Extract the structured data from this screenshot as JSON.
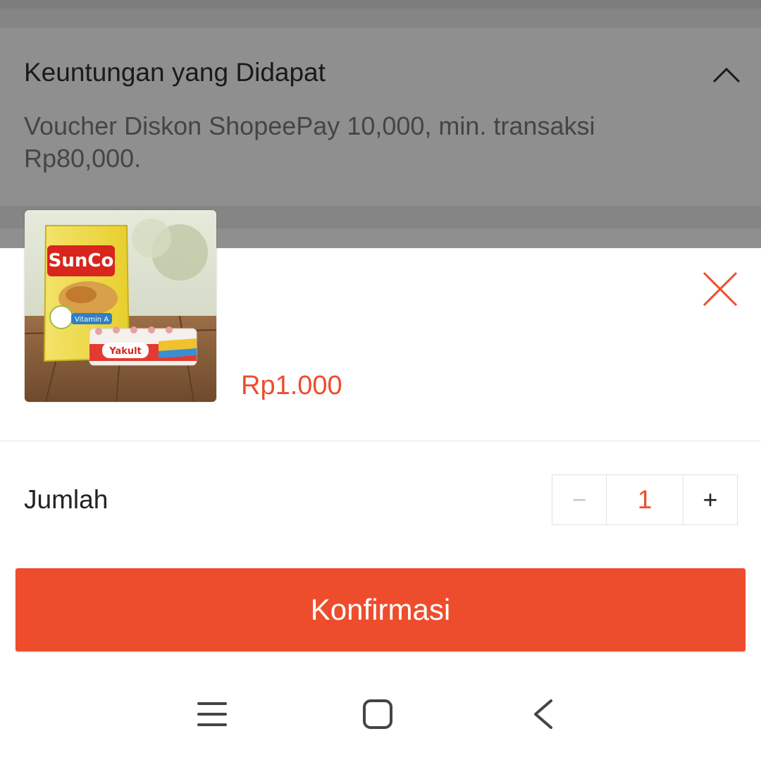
{
  "benefits": {
    "title": "Keuntungan yang Didapat",
    "description": "Voucher Diskon ShopeePay 10,000, min. transaksi Rp80,000."
  },
  "product": {
    "image_brands": [
      "SunCo",
      "Vitamin A",
      "Yakult"
    ],
    "price": "Rp1.000"
  },
  "quantity": {
    "label": "Jumlah",
    "minus": "−",
    "value": "1",
    "plus": "+"
  },
  "confirm_label": "Konfirmasi",
  "colors": {
    "accent": "#ee4d2d",
    "overlay": "#8f8f8f"
  },
  "icons": {
    "collapse": "chevron-up-icon",
    "close": "close-icon",
    "nav_menu": "menu-icon",
    "nav_home": "home-icon",
    "nav_back": "back-icon"
  }
}
